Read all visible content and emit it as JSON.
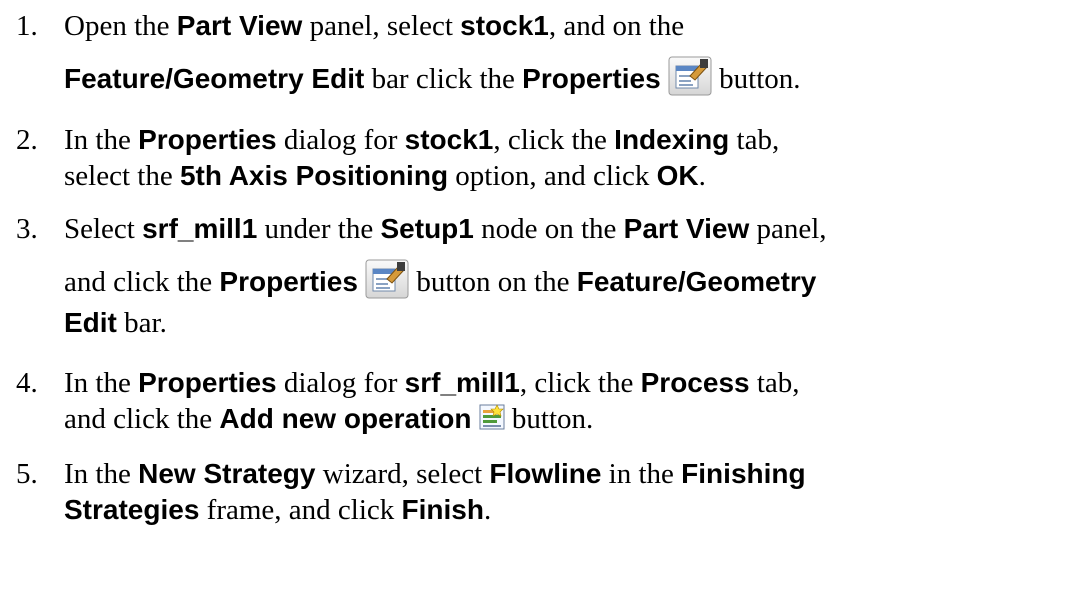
{
  "steps": [
    {
      "num": "1.",
      "l1a": "Open the ",
      "l1b": "Part View",
      "l1c": " panel, select ",
      "l1d": "stock1",
      "l1e": ", and on the",
      "l2a": "Feature/Geometry Edit",
      "l2b": " bar click the ",
      "l2c": "Properties",
      "l2d": " button."
    },
    {
      "num": "2.",
      "l1a": "In the ",
      "l1b": "Properties",
      "l1c": " dialog for ",
      "l1d": "stock1",
      "l1e": ", click the ",
      "l1f": "Indexing",
      "l1g": " tab,",
      "l2a": "select the ",
      "l2b": "5th Axis Positioning",
      "l2c": " option, and click ",
      "l2d": "OK",
      "l2e": "."
    },
    {
      "num": "3.",
      "l1a": "Select ",
      "l1b": "srf_mill1",
      "l1c": " under the ",
      "l1d": "Setup1",
      "l1e": " node on the ",
      "l1f": "Part View",
      "l1g": " panel,",
      "l2a": "and click the ",
      "l2b": "Properties",
      "l2c": " button on the ",
      "l2d": "Feature/Geometry",
      "l3a": "Edit",
      "l3b": " bar."
    },
    {
      "num": "4.",
      "l1a": "In the ",
      "l1b": "Properties",
      "l1c": " dialog for ",
      "l1d": "srf_mill1",
      "l1e": ", click the ",
      "l1f": "Process",
      "l1g": " tab,",
      "l2a": "and click the ",
      "l2b": "Add new operation",
      "l2c": " button."
    },
    {
      "num": "5.",
      "l1a": "In the ",
      "l1b": "New Strategy",
      "l1c": " wizard, select ",
      "l1d": "Flowline",
      "l1e": " in the ",
      "l1f": "Finishing",
      "l2a": "Strategies",
      "l2b": " frame, and click ",
      "l2c": "Finish",
      "l2d": "."
    }
  ],
  "icons": {
    "properties": "properties-icon",
    "add_operation": "add-operation-icon"
  }
}
